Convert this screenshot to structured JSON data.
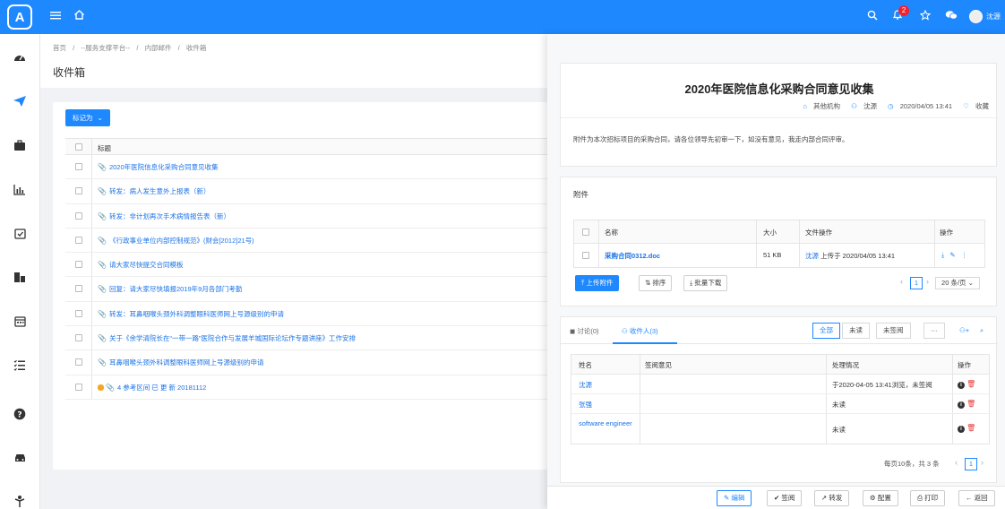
{
  "header": {
    "logo_text": "A",
    "notification_count": "2",
    "user_name": "沈源"
  },
  "breadcrumb": {
    "items": [
      "首页",
      "--服务支撑平台--",
      "内部邮件",
      "收件箱"
    ],
    "separator": "/"
  },
  "page": {
    "title": "收件箱"
  },
  "toolbar": {
    "mark_as_label": "标记为"
  },
  "mail_table": {
    "header_title": "标题",
    "rows": [
      {
        "icon": "📎",
        "title": "2020年医院信息化采购合同意见收集"
      },
      {
        "icon": "📎",
        "title": "转发：病人发生意外上报表（新）"
      },
      {
        "icon": "📎",
        "title": "转发：非计划再次手术病情报告表（新）"
      },
      {
        "icon": "📎",
        "title": "《行政事业单位内部控制规范》(财会[2012]21号)"
      },
      {
        "icon": "📎",
        "title": "请大家尽快提交合同模板"
      },
      {
        "icon": "📎",
        "title": "回复：请大家尽快填报2019年9月各部门考勤"
      },
      {
        "icon": "📎",
        "title": "转发：耳鼻咽喉头颈外科调整眼科医师网上号源级别的申请"
      },
      {
        "icon": "📎",
        "title": "关于《余学清院长在“一带一路”医院合作与发展羊城国际论坛作专题讲座》工作安排"
      },
      {
        "icon": "📎",
        "title": "耳鼻咽喉头颈外科调整眼科医师网上号源级别的申请"
      },
      {
        "icon": "📎",
        "title": "4 参考区间 已 更 新 20181112"
      }
    ]
  },
  "detail": {
    "title": "2020年医院信息化采购合同意见收集",
    "meta": {
      "org": "其他机构",
      "sender": "沈源",
      "time": "2020/04/05 13:41",
      "favorite": "收藏"
    },
    "body": "附件为本次招标项目的采购合同，请各位领导先初审一下，如没有意见，我走内部合同评审。"
  },
  "attachments": {
    "heading": "附件",
    "columns": {
      "name": "名称",
      "size": "大小",
      "file_ops": "文件操作",
      "actions": "操作"
    },
    "rows": [
      {
        "name": "采购合同0312.doc",
        "size": "51 KB",
        "uploader": "沈源",
        "upload_text": "上传于 2020/04/05 13:41"
      }
    ],
    "buttons": {
      "upload": "上传附件",
      "sort": "排序",
      "batch_download": "批量下载"
    },
    "pagination": {
      "page": "1",
      "page_size": "20 条/页"
    }
  },
  "recipients": {
    "tabs": {
      "discussion": "讨论(0)",
      "recipients": "收件人(3)"
    },
    "filters": {
      "all": "全部",
      "unread": "未读",
      "unsigned": "未签阅",
      "more": "···"
    },
    "columns": {
      "name": "姓名",
      "opinion": "签阅意见",
      "status": "处理情况",
      "actions": "操作"
    },
    "rows": [
      {
        "name": "沈源",
        "opinion": "",
        "status": "于2020-04-05 13:41浏览，未签阅"
      },
      {
        "name": "张强",
        "opinion": "",
        "status": "未读"
      },
      {
        "name": "software engineer",
        "opinion": "",
        "status": "未读"
      }
    ],
    "pagination": {
      "summary": "每页10条，共 3 条",
      "page": "1"
    }
  },
  "footer": {
    "edit": "编辑",
    "sign": "签阅",
    "forward": "转发",
    "config": "配置",
    "print": "打印",
    "back": "返回"
  }
}
